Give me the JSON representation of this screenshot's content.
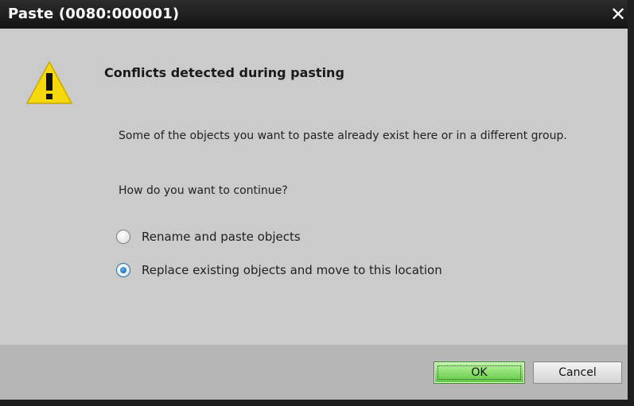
{
  "window": {
    "title": "Paste (0080:000001)",
    "close_glyph": "✕"
  },
  "dialog": {
    "icon": "warning-icon",
    "heading": "Conflicts detected during pasting",
    "message": "Some of the objects you want to paste already exist here or in a different group.",
    "question": "How do you want to continue?"
  },
  "options": [
    {
      "label": "Rename and paste objects",
      "selected": false
    },
    {
      "label": "Replace existing objects and move to this location",
      "selected": true
    }
  ],
  "buttons": {
    "ok": "OK",
    "cancel": "Cancel"
  },
  "colors": {
    "titlebar": "#1e1e1e",
    "body": "#cbcbcb",
    "footer": "#b6b6b6",
    "ok_button": "#58c83a",
    "warning": "#f5d90a"
  }
}
